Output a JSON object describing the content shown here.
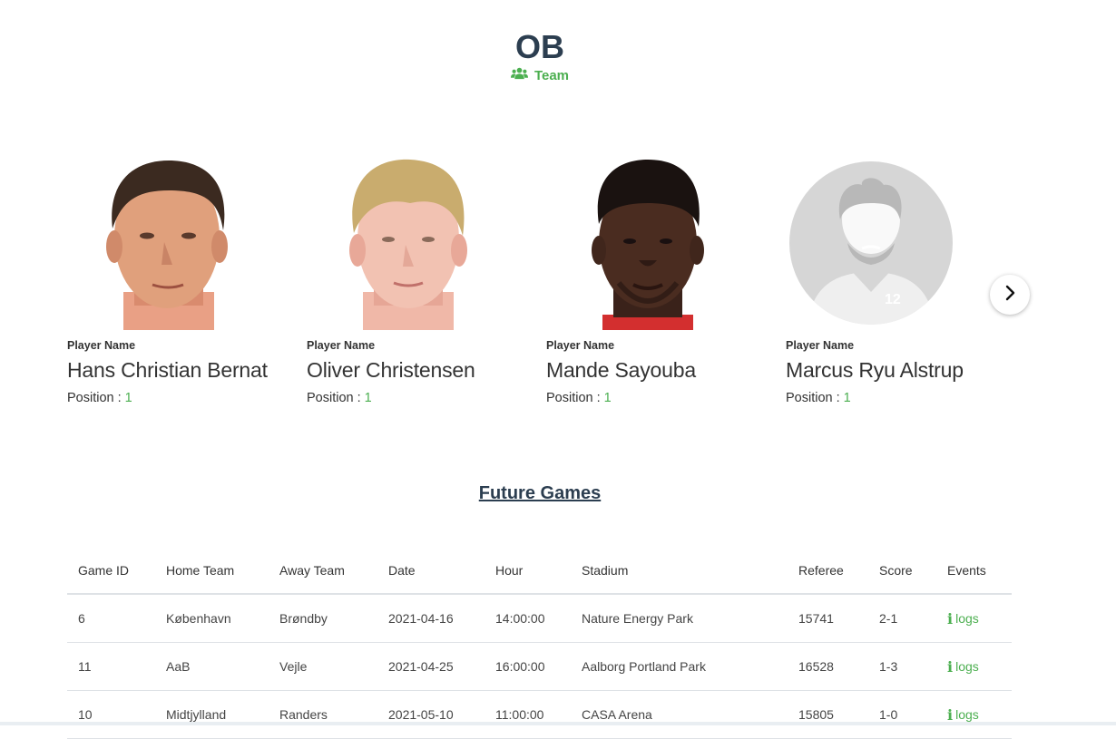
{
  "header": {
    "title": "OB",
    "subtitle": "Team",
    "subtitle_icon": "users-icon",
    "accent_color": "#4caf50"
  },
  "players": [
    {
      "label": "Player Name",
      "name": "Hans Christian Bernat",
      "position_label": "Position : ",
      "position_value": "1",
      "photo": "player-photo"
    },
    {
      "label": "Player Name",
      "name": "Oliver Christensen",
      "position_label": "Position : ",
      "position_value": "1",
      "photo": "player-photo"
    },
    {
      "label": "Player Name",
      "name": "Mande Sayouba",
      "position_label": "Position : ",
      "position_value": "1",
      "photo": "player-photo"
    },
    {
      "label": "Player Name",
      "name": "Marcus Ryu Alstrup",
      "position_label": "Position : ",
      "position_value": "1",
      "photo": "placeholder-avatar",
      "jersey_number": "12"
    }
  ],
  "carousel": {
    "next_icon": "chevron-right-icon"
  },
  "future_games": {
    "title": "Future Games",
    "columns": [
      "Game ID",
      "Home Team",
      "Away Team",
      "Date",
      "Hour",
      "Stadium",
      "Referee",
      "Score",
      "Events"
    ],
    "rows": [
      [
        "6",
        "København",
        "Brøndby",
        "2021-04-16",
        "14:00:00",
        "Nature Energy Park",
        "15741",
        "2-1",
        "logs"
      ],
      [
        "11",
        "AaB",
        "Vejle",
        "2021-04-25",
        "16:00:00",
        "Aalborg Portland Park",
        "16528",
        "1-3",
        "logs"
      ],
      [
        "10",
        "Midtjylland",
        "Randers",
        "2021-05-10",
        "11:00:00",
        "CASA Arena",
        "15805",
        "1-0",
        "logs"
      ]
    ]
  }
}
